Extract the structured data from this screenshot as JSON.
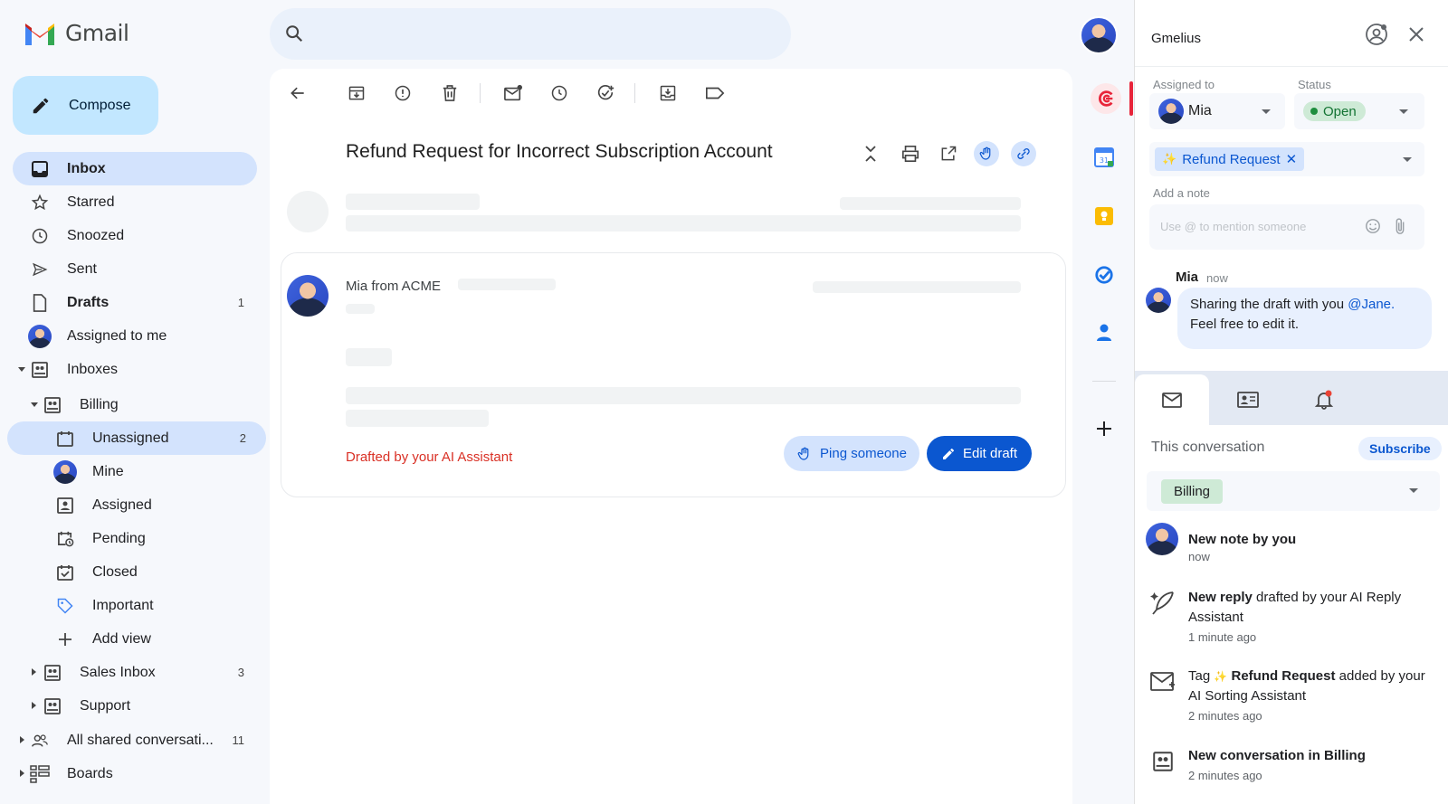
{
  "app": {
    "name": "Gmail",
    "compose_label": "Compose"
  },
  "nav": {
    "inbox": "Inbox",
    "starred": "Starred",
    "snoozed": "Snoozed",
    "sent": "Sent",
    "drafts": "Drafts",
    "drafts_count": "1",
    "assigned_to_me": "Assigned to me",
    "inboxes": "Inboxes",
    "billing": "Billing",
    "unassigned": "Unassigned",
    "unassigned_count": "2",
    "mine": "Mine",
    "assigned": "Assigned",
    "pending": "Pending",
    "closed": "Closed",
    "important": "Important",
    "add_view": "Add view",
    "sales_inbox": "Sales Inbox",
    "sales_count": "3",
    "support": "Support",
    "all_shared": "All shared conversati...",
    "all_shared_count": "11",
    "boards": "Boards"
  },
  "email": {
    "subject": "Refund Request for Incorrect Subscription Account",
    "sender": "Mia from ACME",
    "drafted_note": "Drafted by your AI Assistant",
    "ping_label": "Ping someone",
    "edit_label": "Edit draft"
  },
  "panel": {
    "title": "Gmelius",
    "assigned_to_label": "Assigned to",
    "assignee": "Mia",
    "status_label": "Status",
    "status": "Open",
    "tag_icon": "✨",
    "tag": "Refund Request",
    "add_note_label": "Add a note",
    "note_placeholder": "Use @ to mention someone",
    "comment": {
      "author": "Mia",
      "time": "now",
      "text_before": "Sharing the draft with you ",
      "mention": "@Jane.",
      "text_after": "Feel free to edit it."
    },
    "conversation_label": "This conversation",
    "subscribe_label": "Subscribe",
    "inbox_tag": "Billing",
    "activities": [
      {
        "text": "New note by you",
        "time": "now"
      },
      {
        "bold1": "New reply",
        "rest": " drafted by your AI Reply Assistant",
        "time": "1 minute ago"
      },
      {
        "pre": "Tag ",
        "icon": "✨",
        "bold1": " Refund Request",
        "rest": " added by your AI Sorting Assistant",
        "time": "2 minutes ago"
      },
      {
        "pre": "New conversation",
        "bold1": "",
        "rest": " in Billing",
        "time": "2 minutes ago"
      }
    ]
  },
  "colors": {
    "accent": "#0b57d0",
    "active_nav": "#d3e3fd",
    "danger": "#d93025",
    "open_green": "#137333"
  }
}
